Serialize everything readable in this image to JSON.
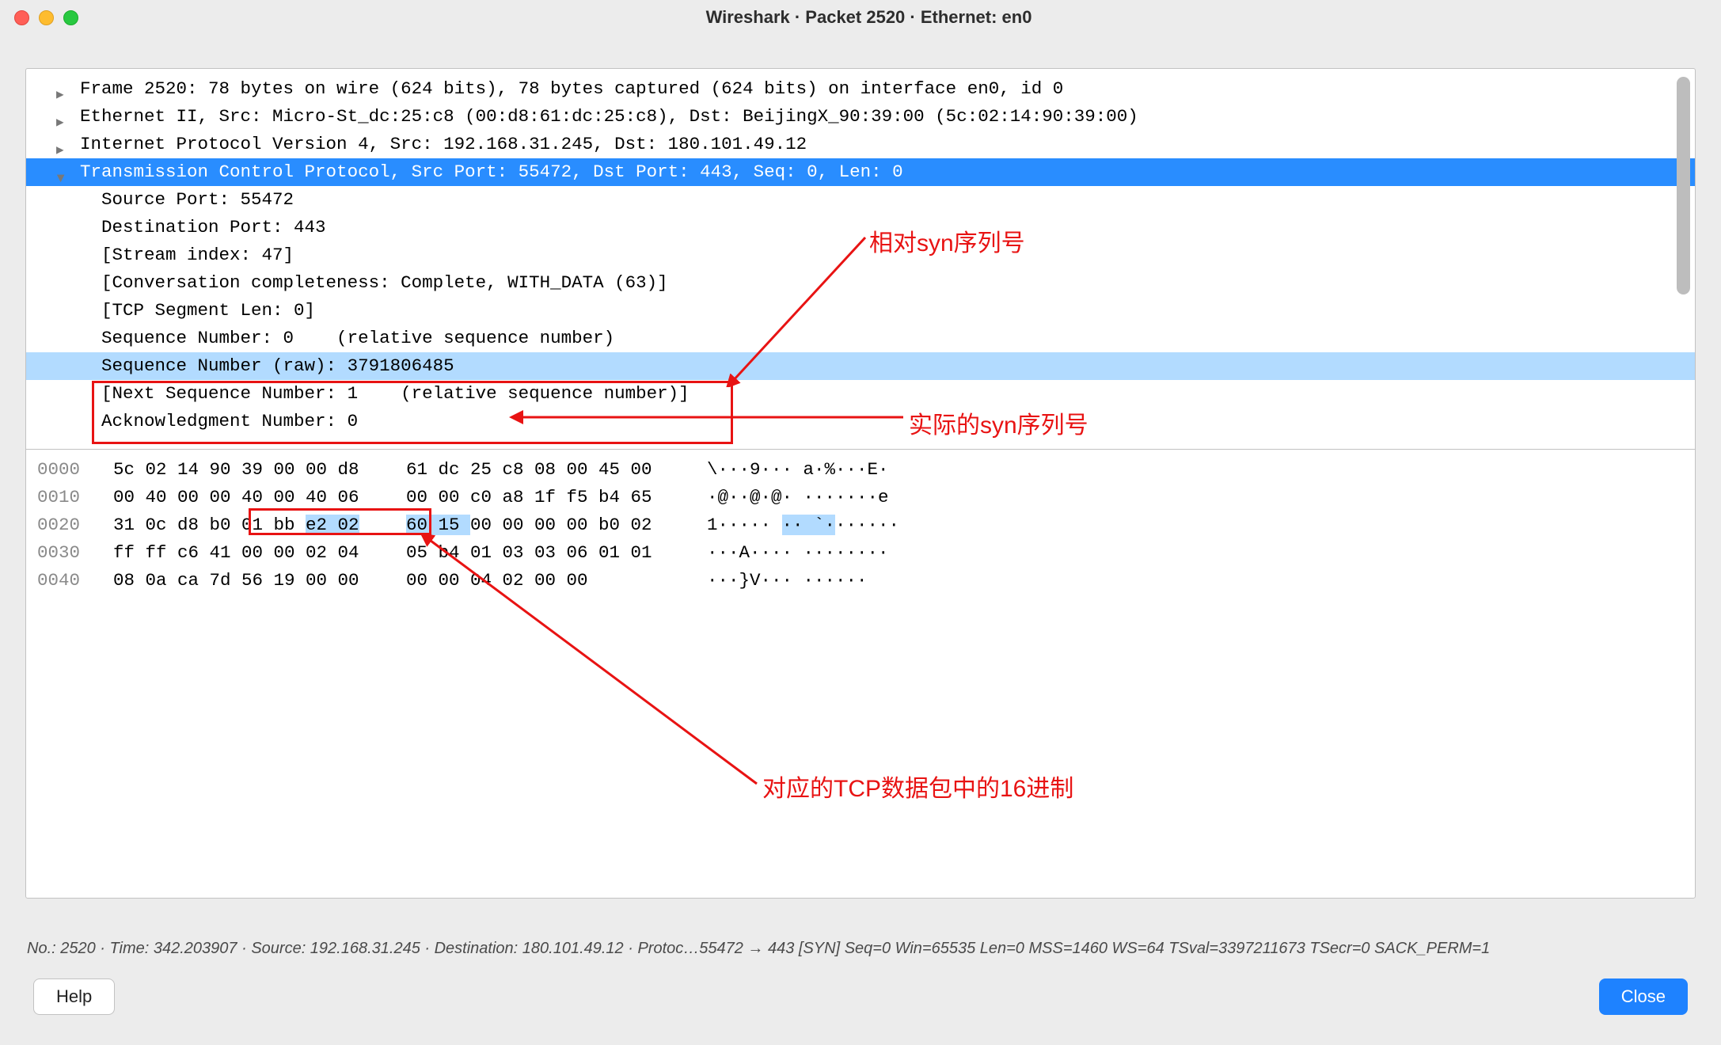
{
  "title": "Wireshark · Packet 2520 · Ethernet: en0",
  "tree": {
    "lines": [
      {
        "pad": "    ",
        "text": "Frame 2520: 78 bytes on wire (624 bits), 78 bytes captured (624 bits) on interface en0, id 0",
        "expand": "closed"
      },
      {
        "pad": "    ",
        "text": "Ethernet II, Src: Micro-St_dc:25:c8 (00:d8:61:dc:25:c8), Dst: BeijingX_90:39:00 (5c:02:14:90:39:00)",
        "expand": "closed"
      },
      {
        "pad": "    ",
        "text": "Internet Protocol Version 4, Src: 192.168.31.245, Dst: 180.101.49.12",
        "expand": "closed"
      },
      {
        "pad": "    ",
        "text": "Transmission Control Protocol, Src Port: 55472, Dst Port: 443, Seq: 0, Len: 0",
        "expand": "open",
        "sel": "dark"
      },
      {
        "pad": "      ",
        "text": "Source Port: 55472"
      },
      {
        "pad": "      ",
        "text": "Destination Port: 443"
      },
      {
        "pad": "      ",
        "text": "[Stream index: 47]"
      },
      {
        "pad": "      ",
        "text": "[Conversation completeness: Complete, WITH_DATA (63)]"
      },
      {
        "pad": "      ",
        "text": "[TCP Segment Len: 0]"
      },
      {
        "pad": "      ",
        "text": "Sequence Number: 0    (relative sequence number)"
      },
      {
        "pad": "      ",
        "text": "Sequence Number (raw): 3791806485",
        "sel": "light"
      },
      {
        "pad": "      ",
        "text": "[Next Sequence Number: 1    (relative sequence number)]"
      },
      {
        "pad": "      ",
        "text": "Acknowledgment Number: 0"
      }
    ]
  },
  "hex": {
    "rows": [
      {
        "offset": "0000",
        "h1": "5c 02 14 90 39 00 00 d8",
        "h2": "61 dc 25 c8 08 00 45 00",
        "ascii": "\\···9··· a·%···E·"
      },
      {
        "offset": "0010",
        "h1": "00 40 00 00 40 00 40 06",
        "h2": "00 00 c0 a8 1f f5 b4 65",
        "ascii": "·@··@·@· ·······e"
      },
      {
        "offset": "0020",
        "h1": "31 0c d8 b0 01 bb ",
        "h1hl": "e2 02",
        "h2hl": "60 15 ",
        "h2b": "00 00 00 00 b0 02",
        "ascii": "1····· ",
        "asciihl": "·· `·",
        "asciib": "······"
      },
      {
        "offset": "0030",
        "h1": "ff ff c6 41 00 00 02 04",
        "h2": "05 b4 01 03 03 06 01 01",
        "ascii": "···A···· ········"
      },
      {
        "offset": "0040",
        "h1": "08 0a ca 7d 56 19 00 00",
        "h2": "00 00 04 02 00 00",
        "ascii": "···}V··· ······"
      }
    ]
  },
  "annotations": {
    "relative_seq": "相对syn序列号",
    "actual_seq": "实际的syn序列号",
    "hex_label": "对应的TCP数据包中的16进制"
  },
  "status": "No.: 2520 · Time: 342.203907 · Source: 192.168.31.245 · Destination: 180.101.49.12 · Protoc…55472 → 443 [SYN] Seq=0 Win=65535 Len=0 MSS=1460 WS=64 TSval=3397211673 TSecr=0 SACK_PERM=1",
  "buttons": {
    "help": "Help",
    "close": "Close"
  }
}
